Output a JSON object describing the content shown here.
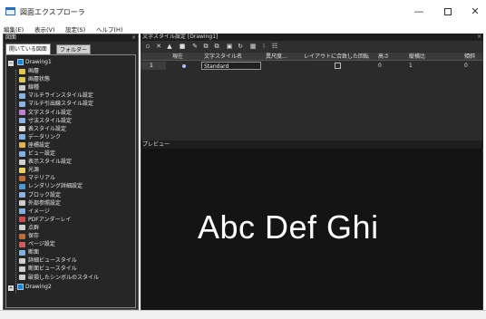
{
  "window": {
    "title": "図面エクスプローラ",
    "controls": {
      "minimize": "—",
      "maximize": "",
      "close": "✕"
    }
  },
  "menu": [
    "編集(E)",
    "表示(V)",
    "設定(S)",
    "ヘルプ(H)"
  ],
  "left_panel": {
    "header": "図面",
    "close": "×",
    "tabs": [
      "開いている図面",
      "フォルダー"
    ],
    "tree": {
      "root1": "Drawing1",
      "root1_expander": "−",
      "items": [
        {
          "label": "画層",
          "icon": "layer-icon",
          "color": "#e3c94a"
        },
        {
          "label": "画層状態",
          "icon": "layer-state-icon",
          "color": "#e3c94a"
        },
        {
          "label": "線種",
          "icon": "linetype-icon",
          "color": "#cccccc"
        },
        {
          "label": "マルチラインスタイル設定",
          "icon": "multiline-style-icon",
          "color": "#8ab4e8"
        },
        {
          "label": "マルチ引出線スタイル設定",
          "icon": "multileader-style-icon",
          "color": "#8ab4e8"
        },
        {
          "label": "文字スタイル設定",
          "icon": "text-style-icon",
          "color": "#c27fd8"
        },
        {
          "label": "寸法スタイル設定",
          "icon": "dimension-style-icon",
          "color": "#8ab4e8"
        },
        {
          "label": "表スタイル設定",
          "icon": "table-style-icon",
          "color": "#dddddd"
        },
        {
          "label": "データリンク",
          "icon": "data-link-icon",
          "color": "#7fb3e8"
        },
        {
          "label": "座標設定",
          "icon": "ucs-icon",
          "color": "#e8b04a"
        },
        {
          "label": "ビュー設定",
          "icon": "view-icon",
          "color": "#7fb3e8"
        },
        {
          "label": "表示スタイル設定",
          "icon": "visual-style-icon",
          "color": "#cfcfcf"
        },
        {
          "label": "光源",
          "icon": "light-icon",
          "color": "#f0d060"
        },
        {
          "label": "マテリアル",
          "icon": "material-icon",
          "color": "#c06a3a"
        },
        {
          "label": "レンダリング詳細設定",
          "icon": "render-icon",
          "color": "#4a9ad8"
        },
        {
          "label": "ブロック設定",
          "icon": "block-icon",
          "color": "#8ab4e8"
        },
        {
          "label": "外部参照設定",
          "icon": "xref-icon",
          "color": "#cfcfcf"
        },
        {
          "label": "イメージ",
          "icon": "image-icon",
          "color": "#7fb3e8"
        },
        {
          "label": "PDFアンダーレイ",
          "icon": "pdf-underlay-icon",
          "color": "#d84a4a"
        },
        {
          "label": "点群",
          "icon": "point-cloud-icon",
          "color": "#cfcfcf"
        },
        {
          "label": "保存",
          "icon": "save-icon",
          "color": "#c06a3a"
        },
        {
          "label": "ページ設定",
          "icon": "page-setup-icon",
          "color": "#d85a5a"
        },
        {
          "label": "断面",
          "icon": "section-icon",
          "color": "#7fb3e8"
        },
        {
          "label": "詳細ビュースタイル",
          "icon": "detail-view-style-icon",
          "color": "#cfcfcf"
        },
        {
          "label": "断面ビュースタイル",
          "icon": "section-view-style-icon",
          "color": "#cfcfcf"
        },
        {
          "label": "破損したシンボルのスタイル",
          "icon": "broken-symbol-style-icon",
          "color": "#cfcfcf"
        }
      ],
      "root2": "Drawing2",
      "root2_expander": "+"
    }
  },
  "document": {
    "header": "文字スタイル設定 [Drawing1]",
    "close": "×",
    "toolbar_icons": [
      "new-icon",
      "delete-icon",
      "purge-icon",
      "folder-icon",
      "brush-icon",
      "copy-icon",
      "paste-icon",
      "save-icon",
      "refresh-icon",
      "grid-view-icon",
      "list-view-icon",
      "settings-icon"
    ],
    "toolbar_glyphs": [
      "▫",
      "✕",
      "▲",
      "■",
      "✎",
      "⧉",
      "⧉",
      "▣",
      "↻",
      "▦",
      "⁝",
      "☷"
    ],
    "columns": [
      "現在",
      "文字スタイル名",
      "異尺度...",
      "レイアウトに合致した回転",
      "高さ",
      "縦横比",
      "傾斜"
    ],
    "row": {
      "number": "1",
      "name": "Standard",
      "height": "0",
      "width_factor": "1",
      "oblique": "0"
    },
    "scroll_left": "<",
    "scroll_right": ">",
    "preview_header": "プレビュー",
    "preview_text": "Abc Def Ghi"
  }
}
